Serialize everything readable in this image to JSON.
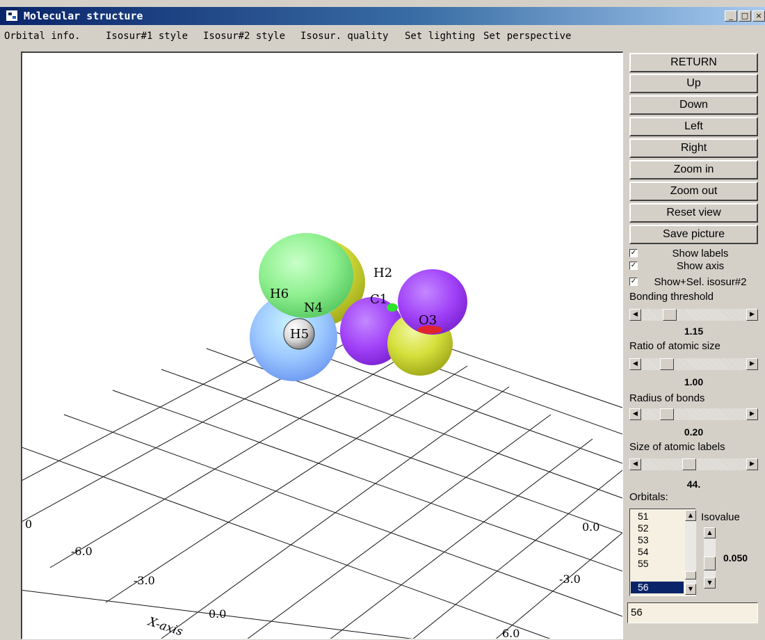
{
  "window": {
    "title": "Molecular structure",
    "controls": {
      "minimize": "_",
      "maximize": "□",
      "close": "×"
    }
  },
  "menu": [
    "Orbital info.",
    "Isosur#1 style",
    "Isosur#2 style",
    "Isosur. quality",
    "Set lighting",
    "Set perspective"
  ],
  "buttons": {
    "return": "RETURN",
    "up": "Up",
    "down": "Down",
    "left": "Left",
    "right": "Right",
    "zoom_in": "Zoom in",
    "zoom_out": "Zoom out",
    "reset_view": "Reset view",
    "save_picture": "Save picture"
  },
  "checkboxes": {
    "show_labels": {
      "label": "Show labels",
      "checked": true
    },
    "show_axis": {
      "label": "Show axis",
      "checked": true
    },
    "show_isosur2": {
      "label": "Show+Sel. isosur#2",
      "checked": true
    }
  },
  "sliders": {
    "bonding_threshold": {
      "label": "Bonding threshold",
      "value": "1.15"
    },
    "atomic_size": {
      "label": "Ratio of atomic size",
      "value": "1.00"
    },
    "bond_radius": {
      "label": "Radius of bonds",
      "value": "0.20"
    },
    "label_size": {
      "label": "Size of atomic labels",
      "value": "44."
    }
  },
  "orbitals": {
    "label": "Orbitals:",
    "items": [
      "51",
      "52",
      "53",
      "54",
      "55",
      "56"
    ],
    "selected": "56",
    "isovalue_label": "Isovalue",
    "isovalue": "0.050",
    "input_value": "56"
  },
  "viewport": {
    "atoms": [
      "H6",
      "N4",
      "H5",
      "H2",
      "C1",
      "O3"
    ],
    "axis_ticks": [
      "0",
      "-6.0",
      "-3.0",
      "0.0",
      "0.0",
      "-3.0",
      "6.0"
    ],
    "axis_label": "X-axis",
    "colors": {
      "lobe_green": "#8ff08f",
      "lobe_blue": "#9cc8ff",
      "lobe_yellow": "#d6e03c",
      "lobe_purple": "#a040f8",
      "lobe_purple_small": "#9a45ff"
    }
  }
}
